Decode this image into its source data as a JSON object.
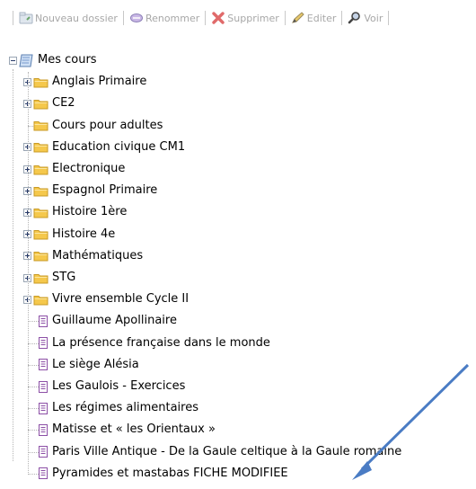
{
  "toolbar": {
    "new_folder": "Nouveau dossier",
    "rename": "Renommer",
    "delete": "Supprimer",
    "edit": "Editer",
    "view": "Voir",
    "disabled_color": "#a7a7a7"
  },
  "tree": {
    "root": "Mes cours",
    "folders": [
      {
        "label": "Anglais Primaire",
        "expandable": true
      },
      {
        "label": "CE2",
        "expandable": true
      },
      {
        "label": "Cours pour adultes",
        "expandable": false
      },
      {
        "label": "Education civique CM1",
        "expandable": true
      },
      {
        "label": "Electronique",
        "expandable": true
      },
      {
        "label": "Espagnol Primaire",
        "expandable": true
      },
      {
        "label": "Histoire 1ère",
        "expandable": true
      },
      {
        "label": "Histoire 4e",
        "expandable": true
      },
      {
        "label": "Mathématiques",
        "expandable": true
      },
      {
        "label": "STG",
        "expandable": true
      },
      {
        "label": "Vivre ensemble Cycle II",
        "expandable": true
      }
    ],
    "documents": [
      "Guillaume Apollinaire",
      "La présence française dans le monde",
      "Le siège Alésia",
      "Les Gaulois - Exercices",
      "Les régimes alimentaires",
      "Matisse et « les Orientaux »",
      "Paris Ville Antique - De la Gaule celtique à la Gaule romaine",
      "Pyramides et mastabas FICHE MODIFIEE"
    ]
  },
  "colors": {
    "folder": "#f5c84c",
    "document": "#8c4fa6",
    "arrow": "#4a7cc4"
  }
}
